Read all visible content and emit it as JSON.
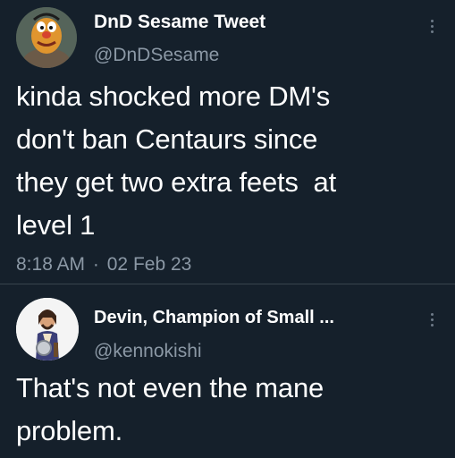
{
  "tweet": {
    "author_name": "DnD Sesame Tweet",
    "author_handle": "@DnDSesame",
    "text_lines": [
      "kinda shocked more DM's",
      "don't ban Centaurs since",
      "they get two extra feets  at",
      "level 1"
    ],
    "time": "8:18 AM",
    "separator": "·",
    "date": "02 Feb 23"
  },
  "reply": {
    "author_name": "Devin, Champion of Small ...",
    "author_handle": "@kennokishi",
    "text_lines": [
      "That's not even the mane",
      "problem."
    ]
  },
  "colors": {
    "background": "#15202b",
    "primary_text": "#ffffff",
    "secondary_text": "#8b98a5",
    "divider": "#38444d"
  },
  "icons": {
    "more": "more-vertical-icon"
  }
}
